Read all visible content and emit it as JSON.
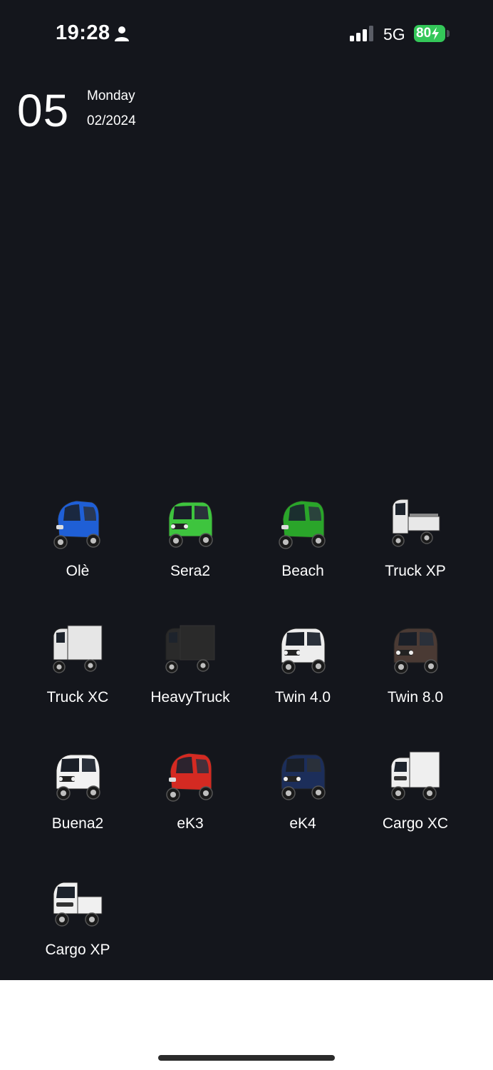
{
  "status_bar": {
    "time": "19:28",
    "network": "5G",
    "battery": "80"
  },
  "date_widget": {
    "day": "05",
    "weekday": "Monday",
    "month_year": "02/2024"
  },
  "vehicles": [
    {
      "label": "Olè",
      "color": "#1f5fd6",
      "style": "trike-cab"
    },
    {
      "label": "Sera2",
      "color": "#3ec43e",
      "style": "car"
    },
    {
      "label": "Beach",
      "color": "#2aa52a",
      "style": "trike-cab"
    },
    {
      "label": "Truck XP",
      "color": "#e8e8e8",
      "style": "pickup-trike"
    },
    {
      "label": "Truck XC",
      "color": "#e6e6e6",
      "style": "box-trike"
    },
    {
      "label": "HeavyTruck",
      "color": "#2a2a2a",
      "style": "box-trike"
    },
    {
      "label": "Twin 4.0",
      "color": "#ededed",
      "style": "car"
    },
    {
      "label": "Twin 8.0",
      "color": "#4a3a34",
      "style": "car"
    },
    {
      "label": "Buena2",
      "color": "#f2f2f2",
      "style": "car"
    },
    {
      "label": "eK3",
      "color": "#d42a22",
      "style": "trike-cab"
    },
    {
      "label": "eK4",
      "color": "#1c2e5a",
      "style": "car"
    },
    {
      "label": "Cargo XC",
      "color": "#efefef",
      "style": "box-car"
    },
    {
      "label": "Cargo XP",
      "color": "#f0f0f0",
      "style": "pickup-car"
    }
  ]
}
